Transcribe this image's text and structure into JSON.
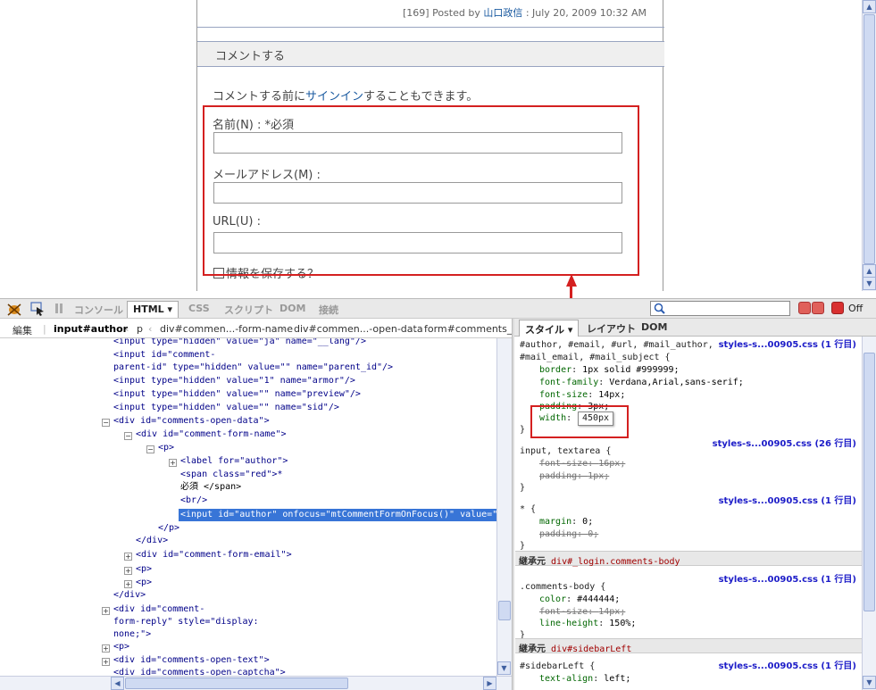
{
  "blog": {
    "posted_prefix": "[169] Posted by ",
    "author": "山口政信",
    "posted_suffix": " : July 20, 2009 10:32 AM",
    "comment_heading": "コメントする",
    "signin_prefix": "コメントする前に",
    "signin_link": "サインイン",
    "signin_suffix": "することもできます。",
    "name_label": "名前(N) : *必須",
    "email_label": "メールアドレス(M) :",
    "url_label": "URL(U) :",
    "remember_label": "情報を保存する？"
  },
  "firebug": {
    "tabs": {
      "console": "コンソール",
      "html": "HTML ▾",
      "css": "CSS",
      "script": "スクリプト",
      "dom": "DOM",
      "net": "接続"
    },
    "off_label": "Off",
    "edit_label": "編集",
    "crumbs": [
      "input#author",
      "p",
      "div#commen...-form-name",
      "div#commen...-open-data",
      "form#comments_fo"
    ],
    "side_tabs": {
      "style": "スタイル ▾",
      "layout": "レイアウト",
      "dom": "DOM"
    }
  },
  "html_lines": [
    "<input type=\"hidden\" value=\"ja\" name=\"__lang\"/>",
    "<input id=\"comment-",
    "parent-id\" type=\"hidden\" value=\"\" name=\"parent_id\"/>",
    "<input type=\"hidden\" value=\"1\" name=\"armor\"/>",
    "<input type=\"hidden\" value=\"\" name=\"preview\"/>",
    "<input type=\"hidden\" value=\"\" name=\"sid\"/>",
    "<div id=\"comments-open-data\">",
    "<div id=\"comment-form-name\">",
    "<p>",
    "<label for=\"author\">",
    "<span class=\"red\">*",
    "必須 </span>",
    "<br/>",
    "<input id=\"author\" onfocus=\"mtCommentFormOnFocus()\" value=\"\"",
    "</p>",
    "</div>",
    "<div id=\"comment-form-email\">",
    "<p>",
    "<p>",
    "</div>",
    "<div id=\"comment-",
    "form-reply\" style=\"display:",
    "none;\">",
    "<p>",
    "<div id=\"comments-open-text\">",
    "<div id=\"comments-open-captcha\">"
  ],
  "styles": {
    "rule1_selector_a": "#author, #email, #url, #mail_author,",
    "rule1_selector_b": "#mail_email, #mail_subject {",
    "rule1_src": "styles-s...00905.css (1 行目)",
    "border": "1px solid #999999;",
    "font_family": "Verdana,Arial,sans-serif;",
    "font_size": "14px;",
    "padding": "3px;",
    "width_tip": "450px",
    "rule2_selector": "input, textarea {",
    "rule2_src": "styles-s...00905.css (26 行目)",
    "r2_font_size": "16px;",
    "r2_padding": "1px;",
    "rule3_selector": "* {",
    "rule3_src": "styles-s...00905.css (1 行目)",
    "r3_margin": "0;",
    "r3_padding": "0;",
    "inherit_label": "継承元",
    "inherit1": "div#_login.comments-body",
    "rule4_selector": ".comments-body {",
    "rule4_src": "styles-s...00905.css (1 行目)",
    "r4_color": "#444444;",
    "r4_font_size": "14px;",
    "r4_line_height": "150%;",
    "inherit2": "div#sidebarLeft",
    "rule5_selector": "#sidebarLeft {",
    "rule5_src": "styles-s...00905.css (1 行目)",
    "r5_text_align": "left;"
  }
}
